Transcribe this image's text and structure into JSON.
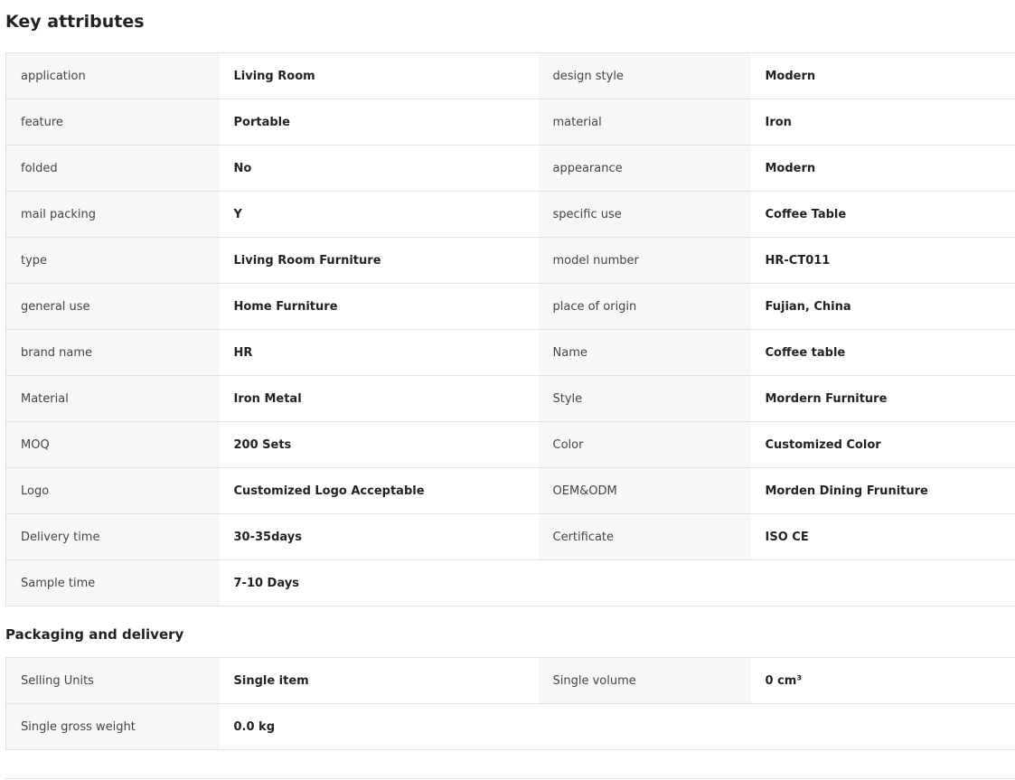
{
  "key_attributes": {
    "title": "Key attributes",
    "rows": [
      {
        "k1": "application",
        "v1": "Living Room",
        "k2": "design style",
        "v2": "Modern"
      },
      {
        "k1": "feature",
        "v1": "Portable",
        "k2": "material",
        "v2": "Iron"
      },
      {
        "k1": "folded",
        "v1": "No",
        "k2": "appearance",
        "v2": "Modern"
      },
      {
        "k1": "mail packing",
        "v1": "Y",
        "k2": "specific use",
        "v2": "Coffee Table"
      },
      {
        "k1": "type",
        "v1": "Living Room Furniture",
        "k2": "model number",
        "v2": "HR-CT011"
      },
      {
        "k1": "general use",
        "v1": "Home Furniture",
        "k2": "place of origin",
        "v2": "Fujian, China"
      },
      {
        "k1": "brand name",
        "v1": "HR",
        "k2": "Name",
        "v2": "Coffee table"
      },
      {
        "k1": "Material",
        "v1": "Iron Metal",
        "k2": "Style",
        "v2": "Mordern Furniture"
      },
      {
        "k1": "MOQ",
        "v1": "200 Sets",
        "k2": "Color",
        "v2": "Customized Color"
      },
      {
        "k1": "Logo",
        "v1": "Customized Logo Acceptable",
        "k2": "OEM&ODM",
        "v2": "Morden Dining Fruniture"
      },
      {
        "k1": "Delivery time",
        "v1": "30-35days",
        "k2": "Certificate",
        "v2": "ISO CE"
      },
      {
        "k1": "Sample time",
        "v1": "7-10 Days"
      }
    ]
  },
  "packaging": {
    "title": "Packaging and delivery",
    "rows": [
      {
        "k1": "Selling Units",
        "v1": "Single item",
        "k2": "Single volume",
        "v2": "0 cm³"
      },
      {
        "k1": "Single gross weight",
        "v1": "0.0 kg"
      }
    ]
  }
}
